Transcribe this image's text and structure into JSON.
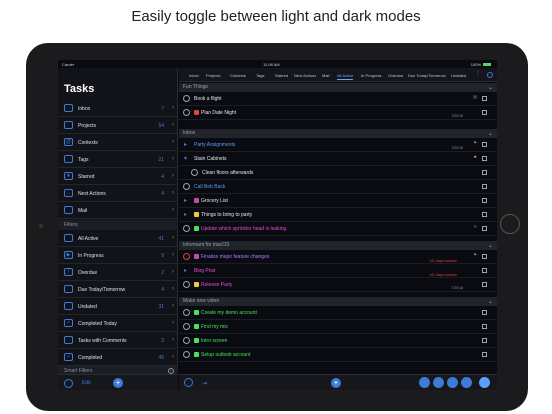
{
  "headline": "Easily toggle between light and dark modes",
  "status": {
    "carrier": "Carrier",
    "time": "11:08 AM",
    "battery": "100%"
  },
  "sidebar": {
    "title": "Tasks",
    "items": [
      {
        "label": "Inbox",
        "count": "7",
        "icon": "inbox-icon"
      },
      {
        "label": "Projects",
        "count": "54",
        "icon": "folder-icon"
      },
      {
        "label": "Contexts",
        "count": "",
        "icon": "at-icon"
      },
      {
        "label": "Tags",
        "count": "21",
        "icon": "tag-icon"
      },
      {
        "label": "Starred",
        "count": "4",
        "icon": "star-icon"
      },
      {
        "label": "Next Actions",
        "count": "4",
        "icon": "arrow-icon"
      },
      {
        "label": "Mail",
        "count": "",
        "icon": "mail-icon"
      }
    ],
    "filters_header": "Filters",
    "filters": [
      {
        "label": "All Active",
        "count": "41",
        "icon": "list-icon"
      },
      {
        "label": "In Progress",
        "count": "9",
        "icon": "play-icon"
      },
      {
        "label": "Overdue",
        "count": "2",
        "icon": "warning-icon"
      },
      {
        "label": "Due Today/Tomorrow",
        "count": "4",
        "icon": "calendar-icon"
      },
      {
        "label": "Undated",
        "count": "31",
        "icon": "calendar-icon"
      },
      {
        "label": "Completed Today",
        "count": "",
        "icon": "check-icon"
      },
      {
        "label": "Tasks with Comments",
        "count": "3",
        "icon": "comment-icon"
      },
      {
        "label": "Completed",
        "count": "45",
        "icon": "check-icon"
      }
    ],
    "smart_filters_header": "Smart Filters",
    "edit_label": "Edit"
  },
  "tabs": [
    "Inbox",
    "Projects",
    "Contexts",
    "Tags",
    "Starred",
    "Next Actions",
    "Mail",
    "All Active",
    "In Progress",
    "Overdue",
    "Due Today/Tomorrow",
    "Undated"
  ],
  "active_tab": "All Active",
  "sections": [
    {
      "title": "Fun Things",
      "tasks": [
        {
          "title": "Book a flight",
          "color": "default"
        },
        {
          "title": "Plan Date Night",
          "color": "default",
          "date": "7/20/18"
        }
      ]
    },
    {
      "title": "Inbox",
      "tasks": [
        {
          "title": "Party Assignments",
          "color": "blue",
          "date": "7/20/18"
        },
        {
          "title": "Stain Cabinets",
          "color": "default"
        },
        {
          "title": "Clean floors afterwards",
          "color": "default"
        },
        {
          "title": "Call Bob Back",
          "color": "blue"
        },
        {
          "title": "Grocery List",
          "color": "default"
        },
        {
          "title": "Things to bring to party",
          "color": "default"
        },
        {
          "title": "Update which sprinkler head is leaking",
          "color": "magenta"
        }
      ]
    },
    {
      "title": "Informant for macOS",
      "tasks": [
        {
          "title": "Finalize major feature changes",
          "color": "purple",
          "overdue": "141 days overdue"
        },
        {
          "title": "Blog Post",
          "color": "magenta",
          "overdue": "141 days overdue"
        },
        {
          "title": "Release Party",
          "color": "magenta",
          "date": "7/20/18"
        }
      ]
    },
    {
      "title": "Make new video",
      "tasks": [
        {
          "title": "Create my demo account",
          "color": "green"
        },
        {
          "title": "Find my mic",
          "color": "green"
        },
        {
          "title": "Intro screen",
          "color": "green"
        },
        {
          "title": "Setup outlook account",
          "color": "green"
        }
      ]
    }
  ]
}
